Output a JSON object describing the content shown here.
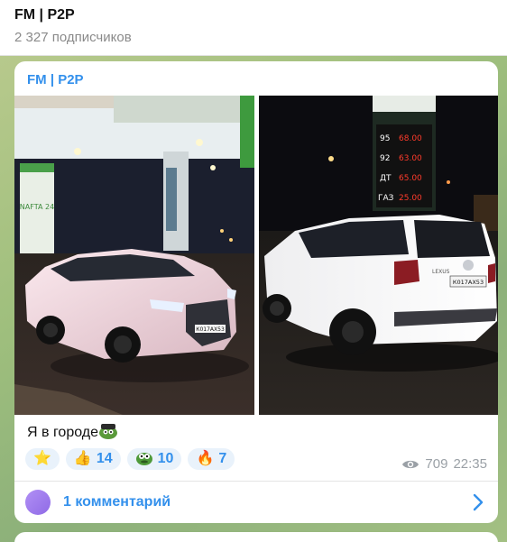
{
  "header": {
    "channel_title": "FM | P2P",
    "subscribers": "2 327 подписчиков"
  },
  "post": {
    "sender": "FM | P2P",
    "text": "Я в городе",
    "photos": {
      "photo1": {
        "station_sign": "NAFTA 24",
        "plate": "К017АХ53"
      },
      "photo2": {
        "prices": [
          {
            "fuel": "95",
            "price": "68.00"
          },
          {
            "fuel": "92",
            "price": "63.00"
          },
          {
            "fuel": "ДТ",
            "price": "65.00"
          },
          {
            "fuel": "ГАЗ",
            "price": "25.00"
          }
        ],
        "plate": "К017АХ53",
        "badge": "LEXUS"
      }
    },
    "reactions": [
      {
        "icon": "star-icon",
        "emoji": "⭐",
        "count": ""
      },
      {
        "icon": "thumbs-up-icon",
        "emoji": "👍",
        "count": "14"
      },
      {
        "icon": "pepe-emoji-icon",
        "emoji": "",
        "count": "10"
      },
      {
        "icon": "fire-icon",
        "emoji": "🔥",
        "count": "7"
      }
    ],
    "views": "709",
    "time": "22:35",
    "comments_label": "1 комментарий"
  },
  "colors": {
    "accent": "#3390ec",
    "reaction_bg": "#e9f2fb",
    "chat_bg": "#9fbf7d"
  }
}
